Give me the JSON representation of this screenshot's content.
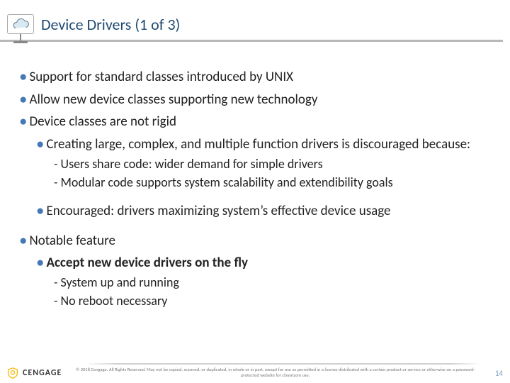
{
  "header": {
    "title": "Device Drivers (1 of 3)",
    "icon_name": "cloud-display-icon"
  },
  "bullets": {
    "p1": "Support for standard classes introduced by UNIX",
    "p2": "Allow new device classes supporting new technology",
    "p3": "Device classes are not rigid",
    "p3_sub1": "Creating large, complex, and multiple function drivers is discouraged because:",
    "p3_sub1_d1": "Users share code: wider demand for simple drivers",
    "p3_sub1_d2": "Modular code supports system scalability and extendibility goals",
    "p3_sub2": "Encouraged: drivers maximizing system’s effective device usage",
    "p4": "Notable feature",
    "p4_sub1": "Accept new device drivers on the fly",
    "p4_sub1_d1": "System up and running",
    "p4_sub1_d2": "No reboot necessary"
  },
  "footer": {
    "brand": "CENGAGE",
    "copyright": "© 2018 Cengage. All Rights Reserved. May not be copied, scanned, or duplicated, in whole or in part, except for use as permitted in a license distributed with a certain product or service or otherwise on a password-protected website for classroom use.",
    "page_number": "14"
  }
}
